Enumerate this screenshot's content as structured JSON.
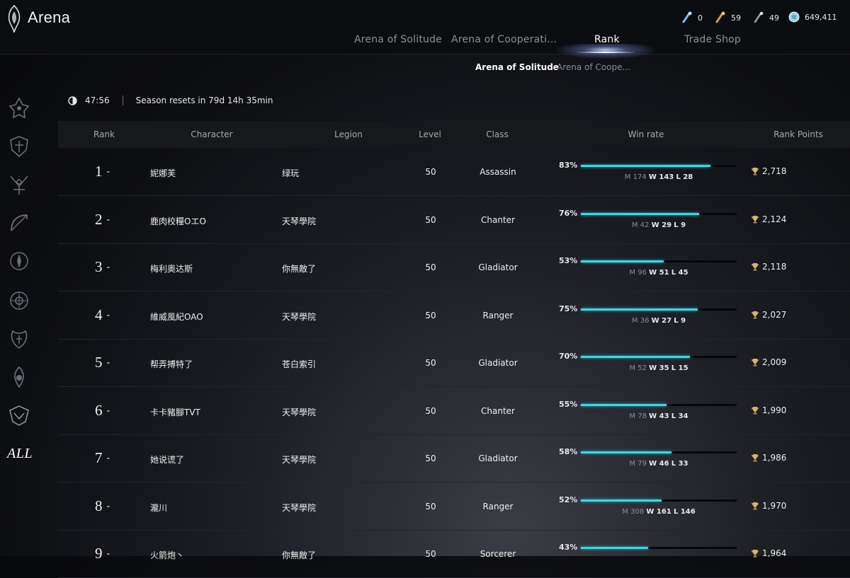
{
  "app": {
    "title": "Arena"
  },
  "currencies": [
    {
      "icon": "key-icon",
      "value": "0"
    },
    {
      "icon": "scroll-icon",
      "value": "59"
    },
    {
      "icon": "wand-icon",
      "value": "49"
    },
    {
      "icon": "coin-icon",
      "value": "649,411"
    }
  ],
  "tabs": [
    {
      "label": "Arena of Solitude",
      "active": false
    },
    {
      "label": "Arena of Cooperati...",
      "active": false
    },
    {
      "label": "Rank",
      "active": true
    },
    {
      "label": "Trade Shop",
      "active": false
    }
  ],
  "subtabs": [
    {
      "label": "Arena of Solitude",
      "active": true
    },
    {
      "label": "Arena of Coope...",
      "active": false
    }
  ],
  "season": {
    "timer": "47:56",
    "reset_text": "Season resets in 79d 14h 35min"
  },
  "sidebar": {
    "class_icons": [
      "gladiator-emblem-icon",
      "templar-emblem-icon",
      "assassin-emblem-icon",
      "ranger-emblem-icon",
      "sorcerer-emblem-icon",
      "spiritmaster-emblem-icon",
      "cleric-emblem-icon",
      "chanter-emblem-icon",
      "aethertech-emblem-icon"
    ],
    "all_label": "ALL"
  },
  "table": {
    "headers": {
      "rank": "Rank",
      "character": "Character",
      "legion": "Legion",
      "level": "Level",
      "class": "Class",
      "winrate": "Win rate",
      "points": "Rank Points"
    },
    "rows": [
      {
        "rank": "1",
        "name": "妮娜芙",
        "legion": "绿玩",
        "level": "50",
        "class": "Assassin",
        "winrate_pct": "83%",
        "winrate_value": 0.83,
        "m": "174",
        "w": "143",
        "l": "28",
        "points": "2,718"
      },
      {
        "rank": "2",
        "name": "鹿肉校糧OエO",
        "legion": "天琴學院",
        "level": "50",
        "class": "Chanter",
        "winrate_pct": "76%",
        "winrate_value": 0.76,
        "m": "42",
        "w": "29",
        "l": "9",
        "points": "2,124"
      },
      {
        "rank": "3",
        "name": "梅利奧达斯",
        "legion": "你無敵了",
        "level": "50",
        "class": "Gladiator",
        "winrate_pct": "53%",
        "winrate_value": 0.53,
        "m": "96",
        "w": "51",
        "l": "45",
        "points": "2,118"
      },
      {
        "rank": "4",
        "name": "維威風紀OAO",
        "legion": "天琴學院",
        "level": "50",
        "class": "Ranger",
        "winrate_pct": "75%",
        "winrate_value": 0.75,
        "m": "36",
        "w": "27",
        "l": "9",
        "points": "2,027"
      },
      {
        "rank": "5",
        "name": "帮弄搏特了",
        "legion": "苍白索引",
        "level": "50",
        "class": "Gladiator",
        "winrate_pct": "70%",
        "winrate_value": 0.7,
        "m": "52",
        "w": "35",
        "l": "15",
        "points": "2,009"
      },
      {
        "rank": "6",
        "name": "卡卡豬腳TVT",
        "legion": "天琴學院",
        "level": "50",
        "class": "Chanter",
        "winrate_pct": "55%",
        "winrate_value": 0.55,
        "m": "78",
        "w": "43",
        "l": "34",
        "points": "1,990"
      },
      {
        "rank": "7",
        "name": "她说谎了",
        "legion": "天琴學院",
        "level": "50",
        "class": "Gladiator",
        "winrate_pct": "58%",
        "winrate_value": 0.58,
        "m": "79",
        "w": "46",
        "l": "33",
        "points": "1,986"
      },
      {
        "rank": "8",
        "name": "瀧川",
        "legion": "天琴學院",
        "level": "50",
        "class": "Ranger",
        "winrate_pct": "52%",
        "winrate_value": 0.52,
        "m": "308",
        "w": "161",
        "l": "146",
        "points": "1,970"
      },
      {
        "rank": "9",
        "name": "火箭炮丶",
        "legion": "你無敵了",
        "level": "50",
        "class": "Sorcerer",
        "winrate_pct": "43%",
        "winrate_value": 0.43,
        "m": "",
        "w": "",
        "l": "",
        "points": "1,964"
      }
    ]
  }
}
